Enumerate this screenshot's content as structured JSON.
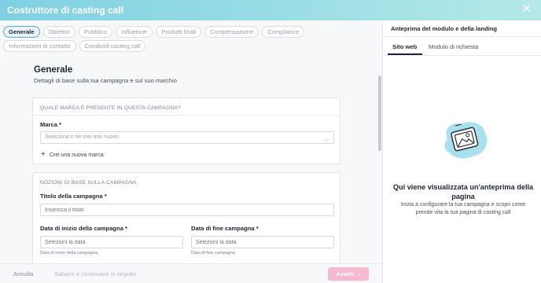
{
  "window": {
    "title": "Costruttore di casting call",
    "close_icon": "close-icon"
  },
  "tabs": [
    {
      "label": "Generale",
      "active": true
    },
    {
      "label": "Obiettivi"
    },
    {
      "label": "Pubblico"
    },
    {
      "label": "Influencer"
    },
    {
      "label": "Prodotti finali"
    },
    {
      "label": "Compensazione"
    },
    {
      "label": "Compliance"
    },
    {
      "label": "Informazioni di contatto"
    },
    {
      "label": "Condividi casting call"
    }
  ],
  "section": {
    "title": "Generale",
    "subtitle": "Dettagli di base sulla tua campagna e sul suo marchio"
  },
  "brand_card": {
    "heading": "QUALE MARCA È PRESENTE IN QUESTA CAMPAGNA?",
    "label": "Marca *",
    "placeholder": "Seleziona o ne crei uno nuovo",
    "add_label": "Crei una nuova marca"
  },
  "campaign_card": {
    "heading": "NOZIONI DI BASE SULLA CAMPAGNA",
    "title_label": "Titolo della campagna *",
    "title_placeholder": "Inserisca il titolo",
    "start_label": "Data di inizio della campagna *",
    "start_placeholder": "Selezioni la data",
    "start_hint": "Data di inizio della campagna",
    "end_label": "Data di fine campagna *",
    "end_placeholder": "Selezioni la data",
    "end_hint": "Data di fine campagna"
  },
  "footer": {
    "cancel": "Annulla",
    "save": "Salvare e continuare in seguito",
    "next": "Avanti"
  },
  "preview": {
    "title": "Anteprima del modulo e della landing",
    "tabs": [
      "Sito web",
      "Modulo di richiesta"
    ],
    "empty_title": "Qui viene visualizzata un'anteprima della pagina",
    "empty_sub": "Inizia a configurare la tua campagna e scopri come prende vita la tua pagina di casting call"
  },
  "colors": {
    "header": "#8fd8e5",
    "next_button": "#f7b9cf",
    "accent": "#5aa9d6"
  }
}
